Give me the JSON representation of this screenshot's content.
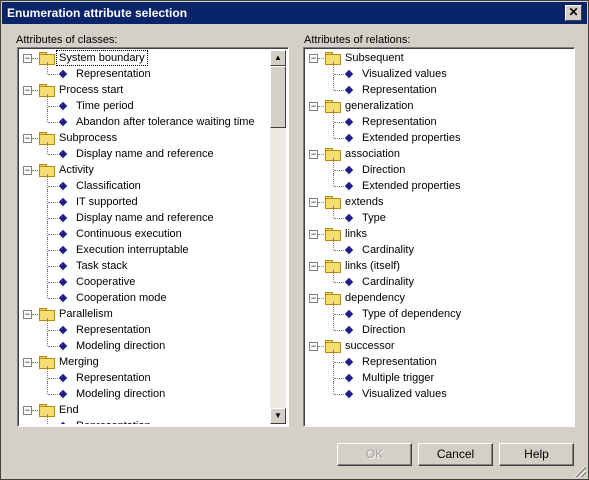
{
  "window": {
    "title": "Enumeration attribute selection",
    "close_glyph": "✕"
  },
  "left_panel": {
    "label": "Attributes of classes:",
    "items": [
      {
        "label": "System boundary",
        "children": [
          "Representation"
        ]
      },
      {
        "label": "Process start",
        "children": [
          "Time period",
          "Abandon after tolerance waiting time"
        ]
      },
      {
        "label": "Subprocess",
        "children": [
          "Display name and reference"
        ]
      },
      {
        "label": "Activity",
        "children": [
          "Classification",
          "IT supported",
          "Display name and reference",
          "Continuous execution",
          "Execution interruptable",
          "Task stack",
          "Cooperative",
          "Cooperation mode"
        ]
      },
      {
        "label": "Parallelism",
        "children": [
          "Representation",
          "Modeling direction"
        ]
      },
      {
        "label": "Merging",
        "children": [
          "Representation",
          "Modeling direction"
        ]
      },
      {
        "label": "End",
        "children": [
          "Representation"
        ]
      }
    ]
  },
  "right_panel": {
    "label": "Attributes of relations:",
    "items": [
      {
        "label": "Subsequent",
        "children": [
          "Visualized values",
          "Representation"
        ]
      },
      {
        "label": "generalization",
        "children": [
          "Representation",
          "Extended properties"
        ]
      },
      {
        "label": "association",
        "children": [
          "Direction",
          "Extended properties"
        ]
      },
      {
        "label": "extends",
        "children": [
          "Type"
        ]
      },
      {
        "label": "links",
        "children": [
          "Cardinality"
        ]
      },
      {
        "label": "links (itself)",
        "children": [
          "Cardinality"
        ]
      },
      {
        "label": "dependency",
        "children": [
          "Type of dependency",
          "Direction"
        ]
      },
      {
        "label": "successor",
        "children": [
          "Representation",
          "Multiple trigger",
          "Visualized values"
        ]
      }
    ]
  },
  "buttons": {
    "ok": "OK",
    "cancel": "Cancel",
    "help": "Help"
  },
  "icons": {
    "expander": "minus-box-icon",
    "folder": "folder-icon",
    "leaf": "diamond-icon",
    "scroll_up": "▲",
    "scroll_down": "▼"
  },
  "colors": {
    "title_bar": "#0a246a",
    "dialog_bg": "#d4d0c8",
    "diamond": "#1f1f8f",
    "folder": "#f6dd74"
  }
}
